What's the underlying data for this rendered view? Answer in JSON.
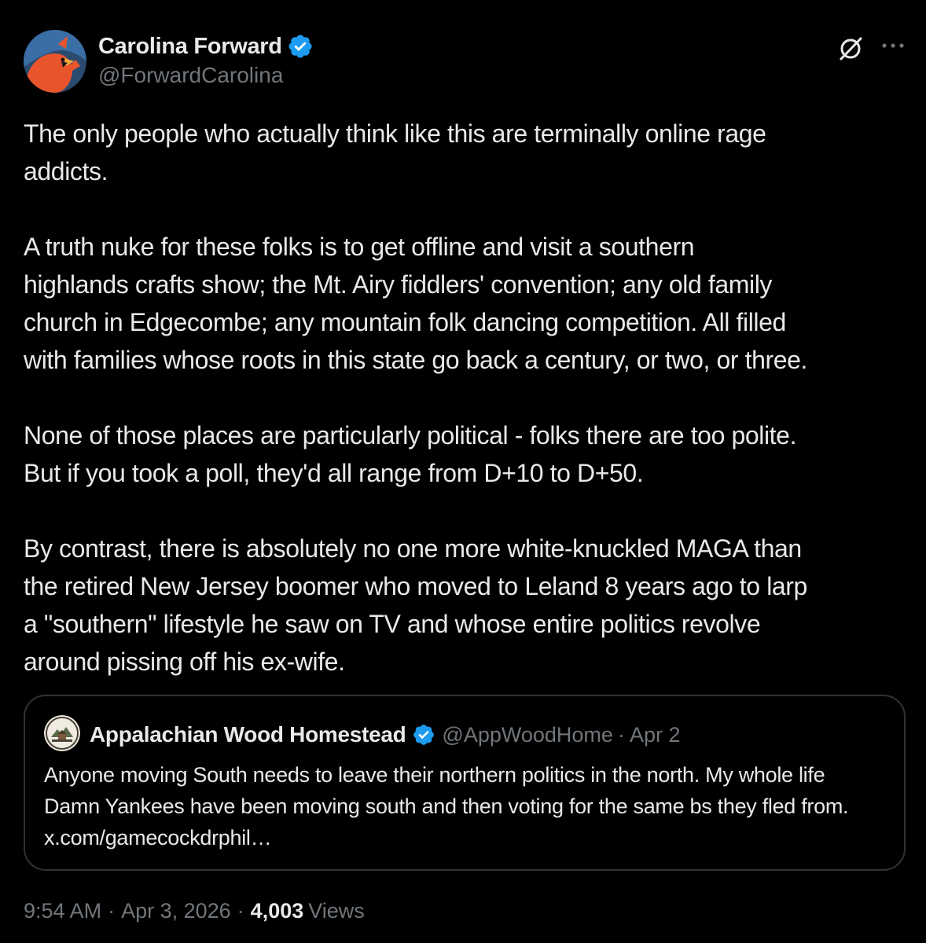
{
  "author": {
    "name": "Carolina Forward",
    "handle": "@ForwardCarolina",
    "verified": true,
    "avatar_icon": "cardinal-bird-logo"
  },
  "header_actions": {
    "grok_icon": "slashed-circle-icon",
    "more_icon": "more-horizontal-icon"
  },
  "tweet": {
    "paragraphs": [
      "The only people who actually think like this are terminally online rage\naddicts.",
      "A truth nuke for these folks is to get offline and visit a southern\nhighlands crafts show; the Mt. Airy fiddlers' convention; any old family\nchurch in Edgecombe; any mountain folk dancing competition. All filled\nwith families whose roots in this state go back a century, or two, or three.",
      "None of those places are particularly political - folks there are too polite.\nBut if you took a poll, they'd all range from D+10 to D+50.",
      "By contrast, there is absolutely no one more white-knuckled MAGA than\nthe retired New Jersey boomer who moved to Leland 8 years ago to larp\na \"southern\" lifestyle he saw on TV and whose entire politics revolve\naround pissing off his ex-wife."
    ]
  },
  "quote": {
    "name": "Appalachian Wood Homestead",
    "handle": "@AppWoodHome",
    "separator": "·",
    "date": "Apr 2",
    "verified": true,
    "text": "Anyone moving South needs to leave their northern politics in the north. My whole life Damn Yankees have been moving south and then voting for the same bs they fled from. x.com/gamecockdrphil…"
  },
  "meta": {
    "time": "9:54 AM",
    "separator": "·",
    "date": "Apr 3, 2026",
    "views_count": "4,003",
    "views_label": "Views"
  },
  "colors": {
    "background": "#000000",
    "text": "#e7e9ea",
    "muted": "#71767b",
    "verified_blue": "#1d9bf0",
    "border": "#2f3336",
    "avatar_bg": "#1e3a5f",
    "cardinal_orange": "#e8552d"
  }
}
